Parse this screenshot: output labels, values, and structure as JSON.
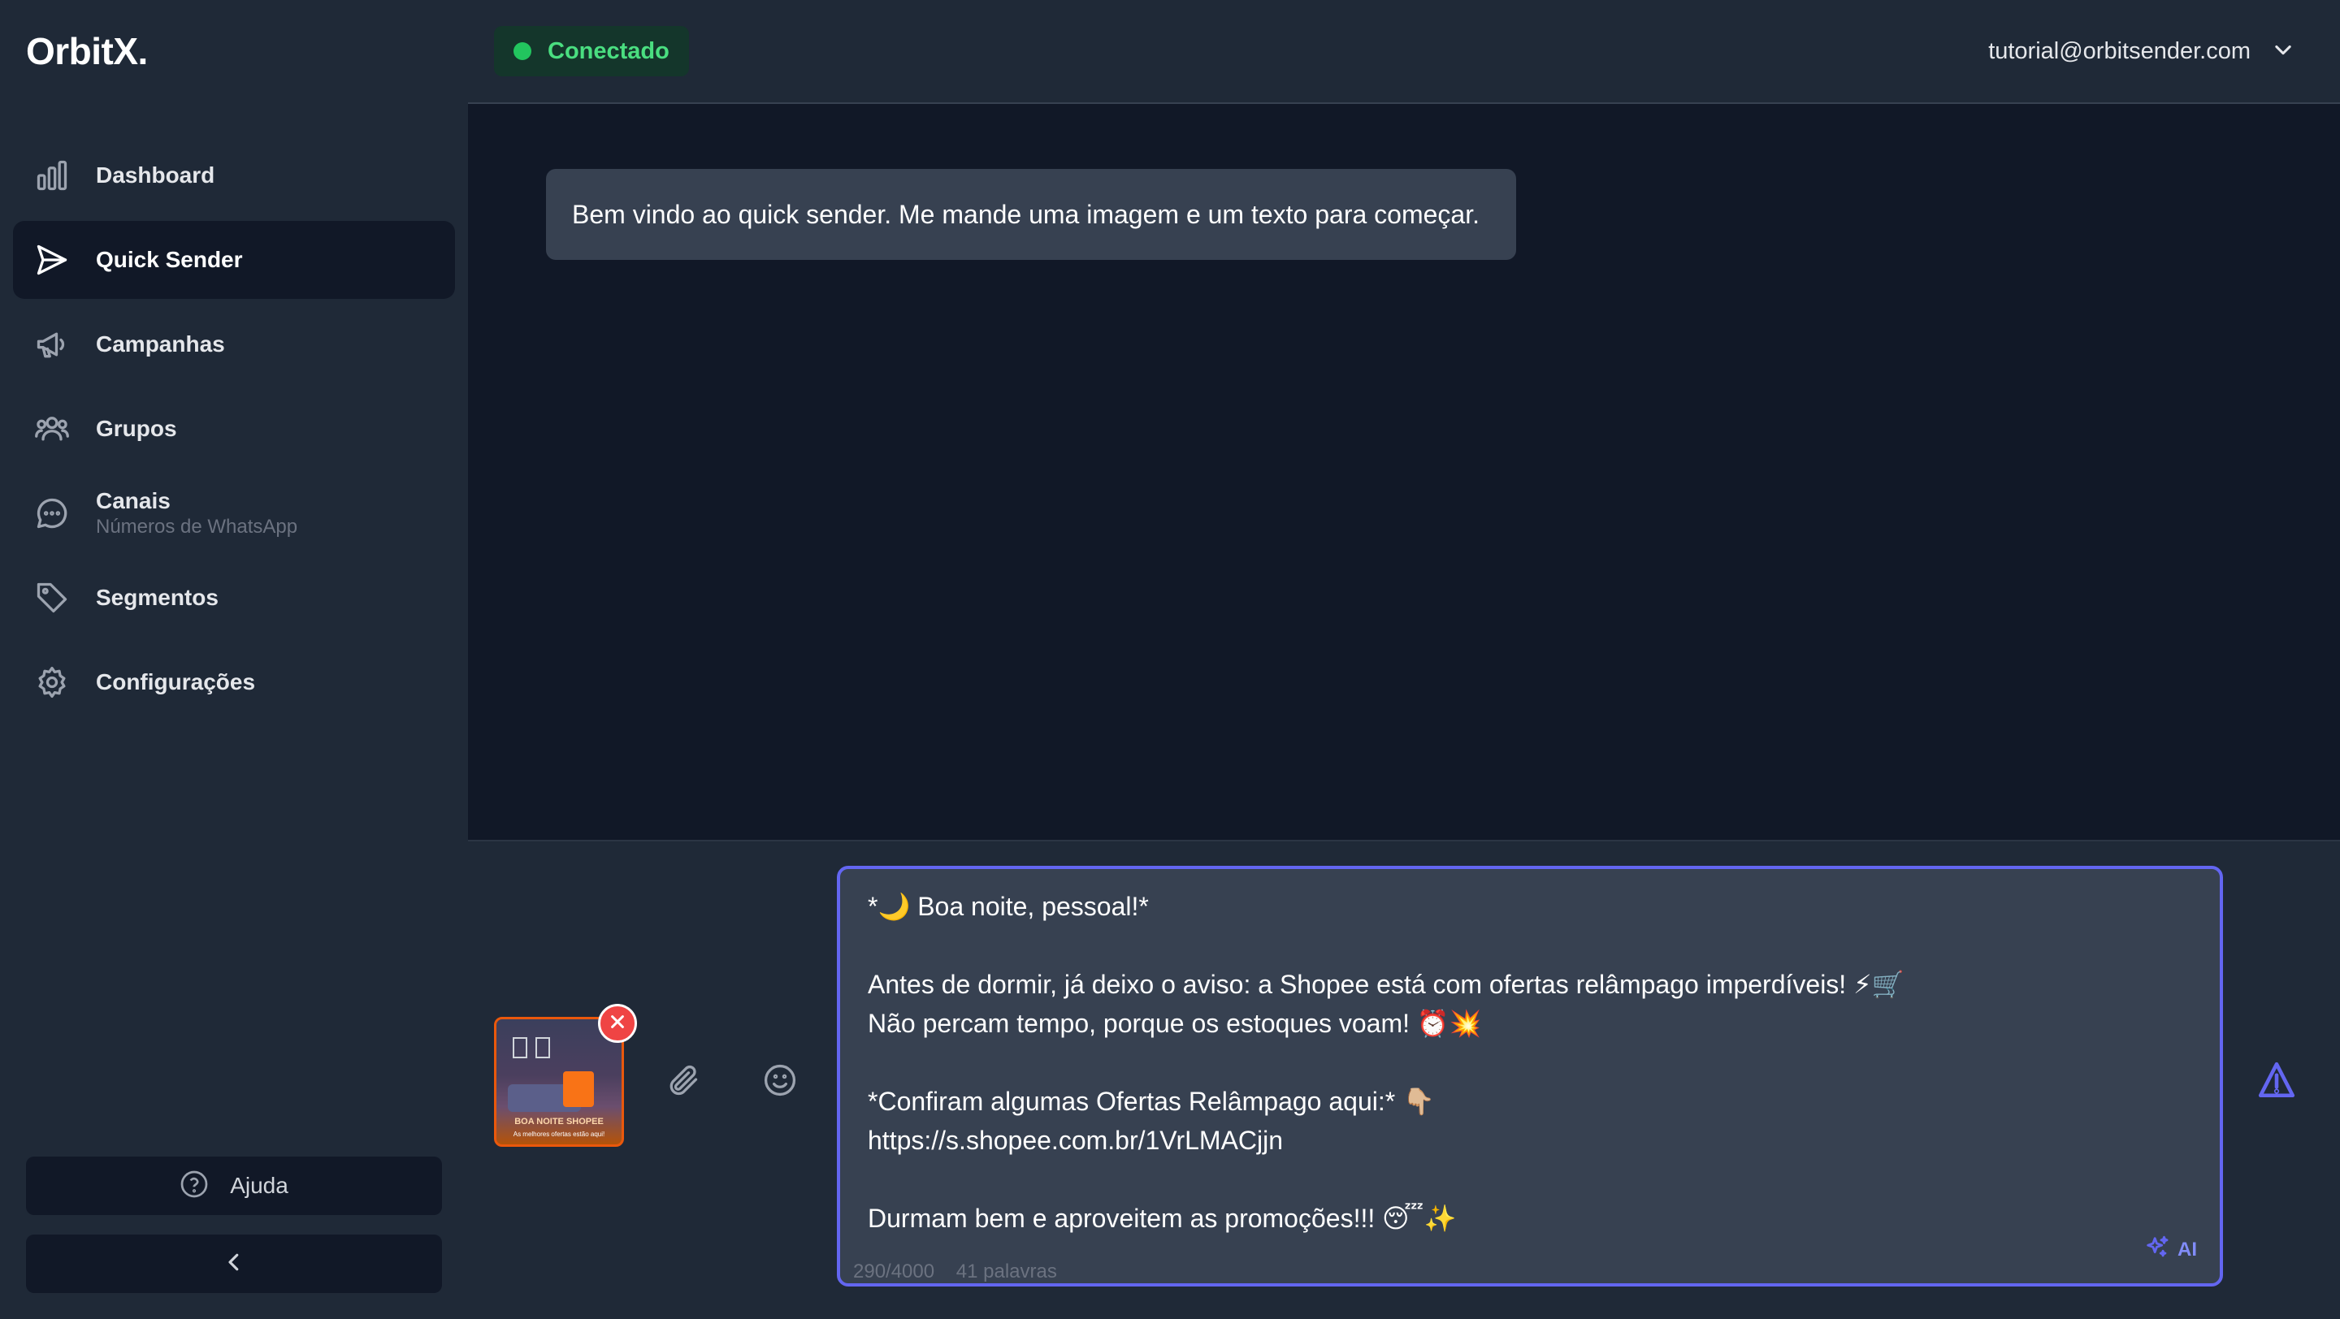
{
  "app": {
    "logo": "OrbitX."
  },
  "sidebar": {
    "items": [
      {
        "label": "Dashboard",
        "icon": "bar-chart-icon",
        "active": false
      },
      {
        "label": "Quick Sender",
        "icon": "send-icon",
        "active": true
      },
      {
        "label": "Campanhas",
        "icon": "megaphone-icon",
        "active": false
      },
      {
        "label": "Grupos",
        "icon": "users-icon",
        "active": false
      },
      {
        "label": "Canais",
        "sublabel": "Números de WhatsApp",
        "icon": "chat-bubble-icon",
        "active": false
      },
      {
        "label": "Segmentos",
        "icon": "tag-icon",
        "active": false
      },
      {
        "label": "Configurações",
        "icon": "gear-icon",
        "active": false
      }
    ],
    "help_label": "Ajuda",
    "collapse_icon": "chevron-left-icon"
  },
  "header": {
    "status": "Conectado",
    "status_color": "#22c55e",
    "user_email": "tutorial@orbitsender.com"
  },
  "chat": {
    "messages": [
      {
        "text": "Bem vindo ao quick sender. Me mande uma imagem e um texto para começar."
      }
    ]
  },
  "composer": {
    "attachment": {
      "caption": "BOA NOITE SHOPEE",
      "subcaption": "As melhores ofertas estão aqui!"
    },
    "message_lines": [
      "*🌙 Boa noite, pessoal!*",
      "",
      "Antes de dormir, já deixo o aviso: a Shopee está com ofertas relâmpago imperdíveis! ⚡🛒",
      "Não percam tempo, porque os estoques voam! ⏰💥",
      "",
      "*Confiram algumas Ofertas Relâmpago aqui:* 👇🏼",
      "https://s.shopee.com.br/1VrLMACjjn",
      "",
      "Durmam bem e aproveitem as promoções!!! 😴✨"
    ],
    "char_count": "290/4000",
    "word_count": "41 palavras",
    "ai_label": "AI",
    "accent_color": "#6366f1"
  }
}
